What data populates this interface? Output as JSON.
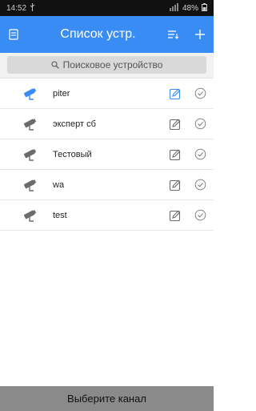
{
  "status_bar": {
    "time": "14:52",
    "battery": "48%"
  },
  "header": {
    "title": "Список устр."
  },
  "search": {
    "placeholder": "Поисковое устройство"
  },
  "devices": [
    {
      "name": "piter",
      "selected": true
    },
    {
      "name": "эксперт сб",
      "selected": false
    },
    {
      "name": "Тестовый",
      "selected": false
    },
    {
      "name": "wa",
      "selected": false
    },
    {
      "name": "test",
      "selected": false
    }
  ],
  "footer": {
    "label": "Выберите канал"
  },
  "colors": {
    "accent": "#3a8cf5",
    "inactive_icon": "#6b6b6b",
    "footer_bg": "#8a8a8a"
  },
  "icons": {
    "menu": "list-icon",
    "sort": "sort-icon",
    "add": "plus-icon",
    "search": "search-icon",
    "device": "camera-icon",
    "edit": "edit-icon",
    "select": "check-circle-icon"
  }
}
